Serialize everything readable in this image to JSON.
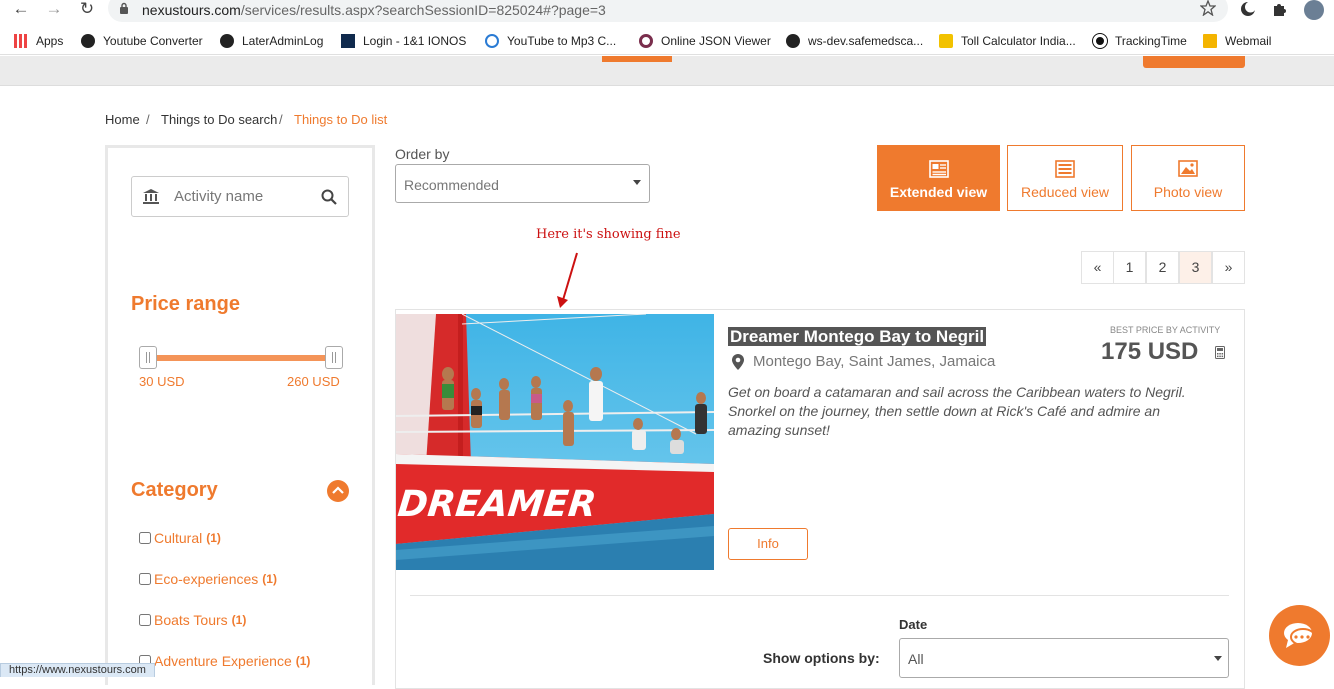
{
  "browser": {
    "url_host": "nexustours.com",
    "url_path": "/services/results.aspx?searchSessionID=825024#?page=3",
    "bookmarks": [
      {
        "label": "Apps",
        "icon": "apps-grid-icon"
      },
      {
        "label": "Youtube Converter",
        "icon": "globe-icon"
      },
      {
        "label": "LaterAdminLog",
        "icon": "globe-icon"
      },
      {
        "label": "Login - 1&1 IONOS",
        "icon": "ionos-icon"
      },
      {
        "label": "YouTube to Mp3 C...",
        "icon": "cloud-download-icon"
      },
      {
        "label": "Online JSON Viewer",
        "icon": "json-viewer-icon"
      },
      {
        "label": "ws-dev.safemedsca...",
        "icon": "globe-icon"
      },
      {
        "label": "Toll Calculator India...",
        "icon": "toll-icon"
      },
      {
        "label": "TrackingTime",
        "icon": "tracking-icon"
      },
      {
        "label": "Webmail",
        "icon": "mail-icon"
      }
    ],
    "status_url": "https://www.nexustours.com"
  },
  "breadcrumb": {
    "home": "Home",
    "sep": "/",
    "search": "Things to Do search",
    "current": "Things to Do list"
  },
  "sidebar": {
    "search_placeholder": "Activity name",
    "price_heading": "Price range",
    "price_min": "30 USD",
    "price_max": "260 USD",
    "category_heading": "Category",
    "categories": [
      {
        "label": "Cultural",
        "count": "(1)"
      },
      {
        "label": "Eco-experiences",
        "count": "(1)"
      },
      {
        "label": "Boats Tours",
        "count": "(1)"
      },
      {
        "label": "Adventure Experience",
        "count": "(1)"
      }
    ]
  },
  "order": {
    "label": "Order by",
    "selected": "Recommended"
  },
  "views": {
    "extended": "Extended view",
    "reduced": "Reduced view",
    "photo": "Photo view"
  },
  "pagination": {
    "prev": "«",
    "pages": [
      "1",
      "2",
      "3"
    ],
    "next": "»",
    "current_page": "3"
  },
  "annotation": "Here it's showing fine",
  "activity": {
    "image_caption": "DREAMER",
    "title": "Dreamer Montego Bay to Negril",
    "location": "Montego Bay, Saint James, Jamaica",
    "best_price_label": "BEST PRICE BY ACTIVITY",
    "price": "175 USD",
    "description": "Get on board a catamaran and sail across the Caribbean waters to Negril. Snorkel on the journey, then settle down at Rick's Café and admire an amazing sunset!",
    "info_button": "Info",
    "date_label": "Date",
    "show_options_label": "Show options by:",
    "date_selected": "All"
  },
  "colors": {
    "accent": "#ef7a2e",
    "annotation_red": "#cc1111"
  }
}
